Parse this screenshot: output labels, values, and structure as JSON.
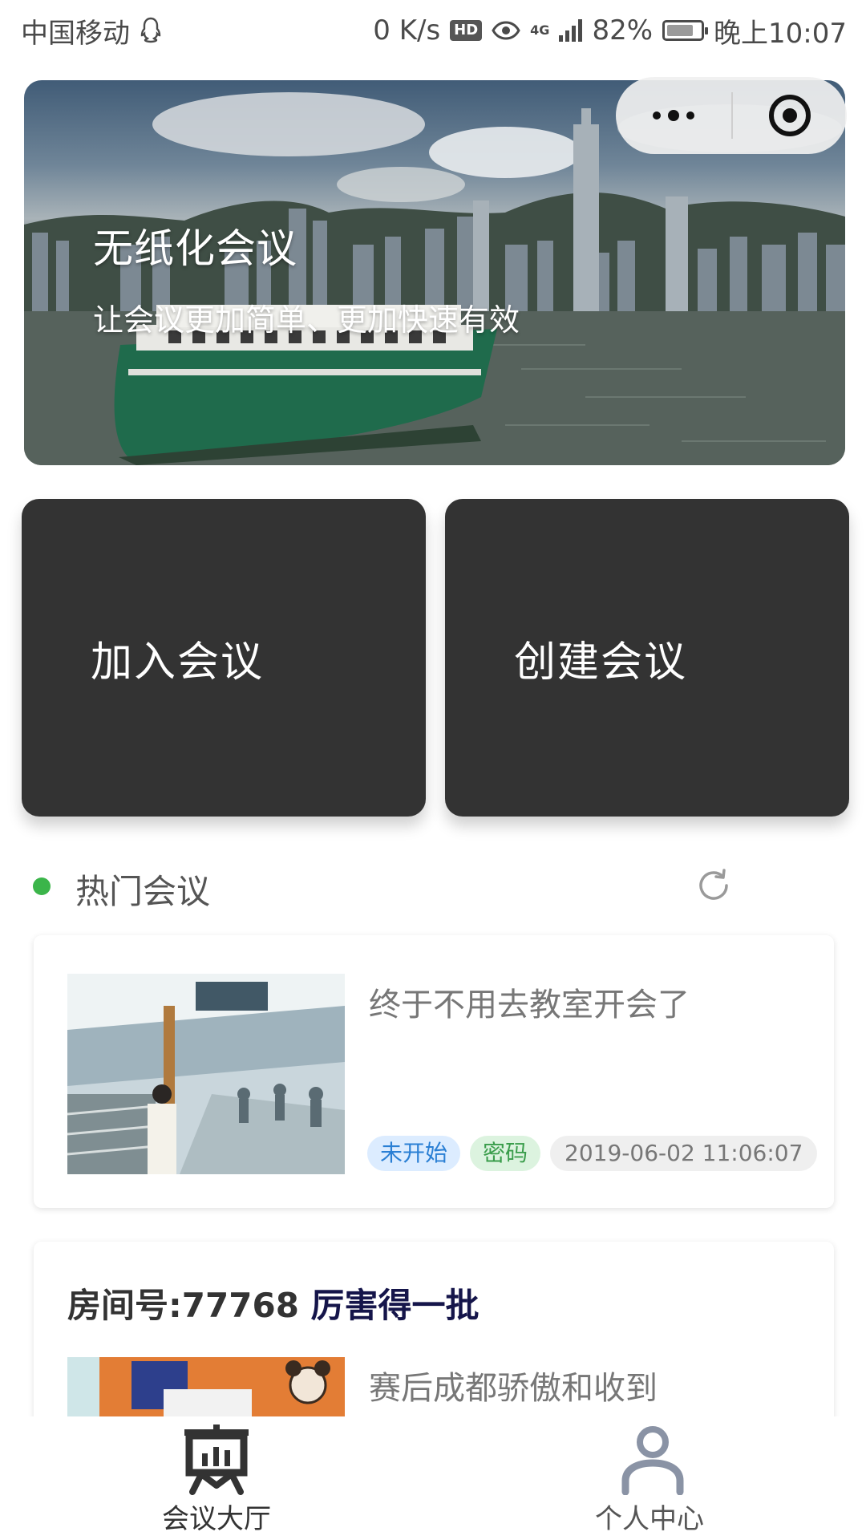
{
  "status_bar": {
    "carrier": "中国移动",
    "speed": "0 K/s",
    "hd": "HD",
    "network": "4G",
    "battery": "82%",
    "time": "晚上10:07"
  },
  "hero": {
    "title": "无纸化会议",
    "subtitle": "让会议更加简单、更加快速有效"
  },
  "actions": {
    "join": "加入会议",
    "create": "创建会议"
  },
  "hot": {
    "title": "热门会议",
    "accent_color": "#3bb54a"
  },
  "meetings": [
    {
      "name": "终于不用去教室开会了",
      "status": "未开始",
      "lock": "密码",
      "time": "2019-06-02 11:06:07"
    },
    {
      "room_label": "房间号:77768",
      "room_name": "厉害得一批",
      "name": "赛后成都骄傲和收到"
    }
  ],
  "tabs": [
    {
      "label": "会议大厅",
      "icon": "presentation-board-icon",
      "active": true
    },
    {
      "label": "个人中心",
      "icon": "user-icon",
      "active": false
    }
  ]
}
